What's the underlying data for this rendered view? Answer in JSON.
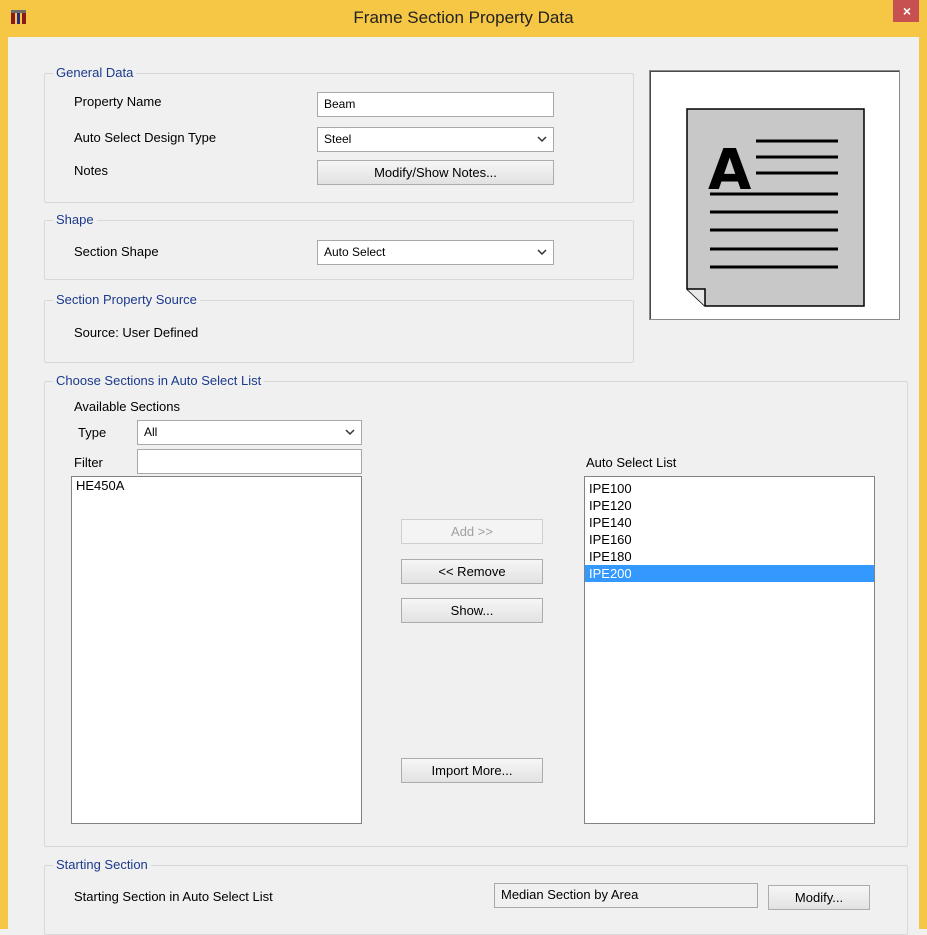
{
  "window": {
    "title": "Frame Section Property Data",
    "close_label": "×"
  },
  "general": {
    "title": "General Data",
    "property_name_label": "Property Name",
    "property_name_value": "Beam",
    "design_type_label": "Auto Select Design Type",
    "design_type_value": "Steel",
    "notes_label": "Notes",
    "notes_button": "Modify/Show Notes..."
  },
  "shape": {
    "title": "Shape",
    "section_shape_label": "Section Shape",
    "section_shape_value": "Auto Select"
  },
  "source": {
    "title": "Section Property Source",
    "text": "Source:  User Defined"
  },
  "choose": {
    "title": "Choose Sections in Auto Select List",
    "available_label": "Available Sections",
    "type_label": "Type",
    "type_value": "All",
    "filter_label": "Filter",
    "filter_value": "",
    "available_items": [
      "HE450A"
    ],
    "add_button": "Add  >>",
    "remove_button": "<<  Remove",
    "show_button": "Show...",
    "import_button": "Import More...",
    "auto_list_label": "Auto Select List",
    "auto_items": [
      "IPE100",
      "IPE120",
      "IPE140",
      "IPE160",
      "IPE180",
      "IPE200"
    ],
    "selected_auto_item": "IPE200"
  },
  "starting": {
    "title": "Starting Section",
    "label": "Starting Section in Auto Select List",
    "value": "Median Section by Area",
    "modify_button": "Modify..."
  },
  "icons": {
    "app": "sap-app-icon",
    "preview": "section-preview-document-icon",
    "dropdown": "chevron-down-icon"
  }
}
